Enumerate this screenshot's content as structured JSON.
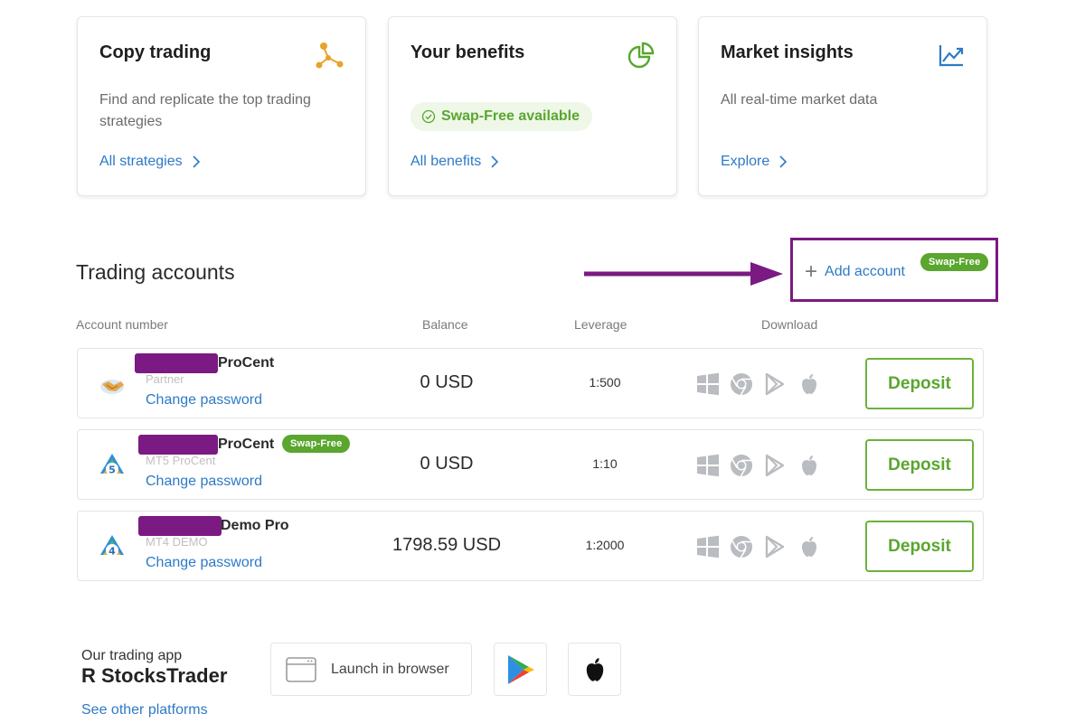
{
  "cards": [
    {
      "title": "Copy trading",
      "description": "Find and replicate the top trading strategies",
      "link": "All strategies"
    },
    {
      "title": "Your benefits",
      "badge": "Swap-Free available",
      "link": "All benefits"
    },
    {
      "title": "Market insights",
      "description": "All real-time market data",
      "link": "Explore"
    }
  ],
  "accounts_section": {
    "title": "Trading accounts",
    "add_label": "Add account",
    "add_badge": "Swap-Free",
    "columns": [
      "Account number",
      "Balance",
      "Leverage",
      "Download"
    ]
  },
  "accounts": [
    {
      "name": "ProCent",
      "subtitle": "Partner",
      "change_password": "Change password",
      "balance": "0 USD",
      "leverage": "1:500",
      "deposit": "Deposit"
    },
    {
      "name": "ProCent",
      "badge": "Swap-Free",
      "subtitle": "MT5 ProCent",
      "change_password": "Change password",
      "balance": "0 USD",
      "leverage": "1:10",
      "deposit": "Deposit"
    },
    {
      "name": "Demo Pro",
      "subtitle": "MT4 DEMO",
      "change_password": "Change password",
      "balance": "1798.59 USD",
      "leverage": "1:2000",
      "deposit": "Deposit"
    }
  ],
  "trading_app": {
    "label": "Our trading app",
    "name": "R StocksTrader",
    "launch": "Launch in browser",
    "other_platforms": "See other platforms"
  },
  "colors": {
    "link": "#2d7ac6",
    "green": "#5aa62e",
    "highlight": "#7a1a82"
  },
  "icons": [
    "copy-trading-icon",
    "pie-chart-icon",
    "trend-chart-icon",
    "windows-icon",
    "chrome-icon",
    "google-play-icon",
    "apple-icon",
    "browser-window-icon"
  ]
}
